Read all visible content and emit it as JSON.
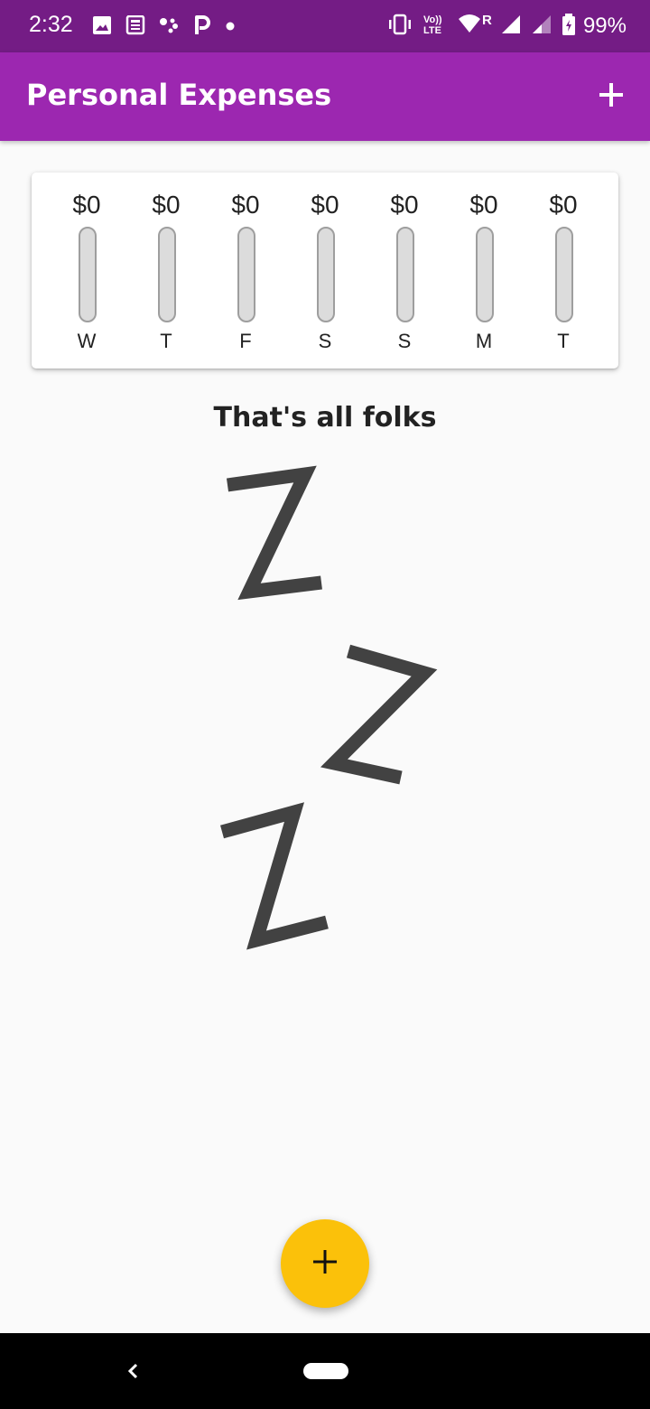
{
  "status_bar": {
    "time": "2:32",
    "battery_percent": "99%",
    "roaming_indicator": "R",
    "volte_label": "Vo)) LTE",
    "left_icons": [
      "image-icon",
      "news-icon",
      "assistant-dots-icon",
      "parking-p-icon",
      "notification-dot-icon"
    ],
    "right_icons": [
      "vibrate-icon",
      "volte-icon",
      "wifi-icon",
      "signal-icon",
      "signal-icon",
      "battery-charging-icon"
    ]
  },
  "app_bar": {
    "title": "Personal Expenses",
    "add_icon": "plus-icon"
  },
  "chart": {
    "bars": [
      {
        "amount": "$0",
        "day": "W",
        "fill": 0
      },
      {
        "amount": "$0",
        "day": "T",
        "fill": 0
      },
      {
        "amount": "$0",
        "day": "F",
        "fill": 0
      },
      {
        "amount": "$0",
        "day": "S",
        "fill": 0
      },
      {
        "amount": "$0",
        "day": "S",
        "fill": 0
      },
      {
        "amount": "$0",
        "day": "M",
        "fill": 0
      },
      {
        "amount": "$0",
        "day": "T",
        "fill": 0
      }
    ]
  },
  "empty_state": {
    "title": "That's all folks",
    "illustration": "sleeping-zzz-icon"
  },
  "fab": {
    "icon": "plus-icon"
  },
  "nav_bar": {
    "back_icon": "back-chevron-icon",
    "home_icon": "home-pill-icon"
  },
  "colors": {
    "status_bar": "#741c85",
    "app_bar": "#9c27b0",
    "fab": "#fbc10a",
    "background": "#fafafa"
  }
}
